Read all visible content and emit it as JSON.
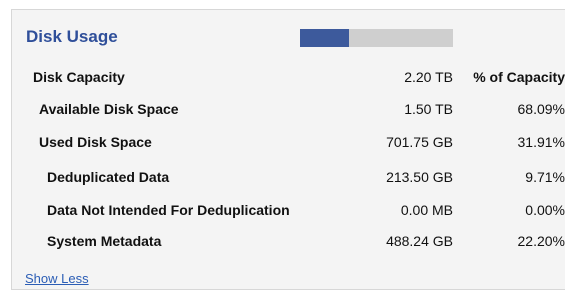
{
  "panel": {
    "title": "Disk Usage",
    "usage_bar": {
      "fraction_used": 0.3191,
      "fill_color": "#3d5a9c",
      "track_color": "#cfcfcf"
    }
  },
  "rows": [
    {
      "label": "Disk Capacity",
      "value": "2.20 TB",
      "pct": "% of Capacity"
    },
    {
      "label": "Available Disk Space",
      "value": "1.50 TB",
      "pct": "68.09%"
    },
    {
      "label": "Used Disk Space",
      "value": "701.75 GB",
      "pct": "31.91%"
    },
    {
      "label": "Deduplicated Data",
      "value": "213.50 GB",
      "pct": "9.71%"
    },
    {
      "label": "Data Not Intended For Deduplication",
      "value": "0.00 MB",
      "pct": "0.00%"
    },
    {
      "label": "System Metadata",
      "value": "488.24 GB",
      "pct": "22.20%"
    }
  ],
  "links": {
    "show_less": "Show Less"
  }
}
